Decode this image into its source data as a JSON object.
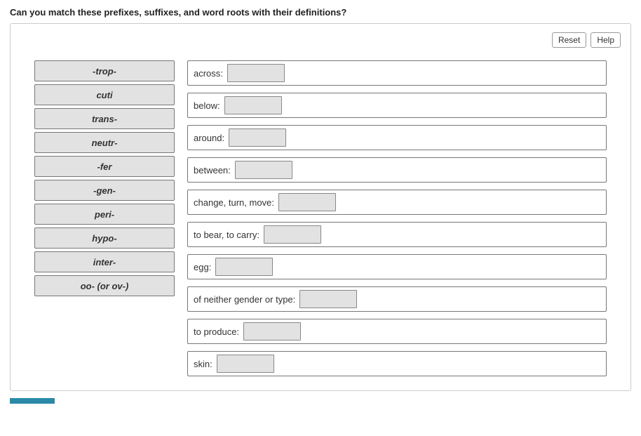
{
  "question": "Can you match these prefixes, suffixes, and word roots with their definitions?",
  "toolbar": {
    "reset": "Reset",
    "help": "Help"
  },
  "sources": [
    "-trop-",
    "cuti",
    "trans-",
    "neutr-",
    "-fer",
    "-gen-",
    "peri-",
    "hypo-",
    "inter-",
    "oo- (or ov-)"
  ],
  "targets": [
    "across:",
    "below:",
    "around:",
    "between:",
    "change, turn, move:",
    "to bear, to carry:",
    "egg:",
    "of neither gender or type:",
    "to produce:",
    "skin:"
  ]
}
